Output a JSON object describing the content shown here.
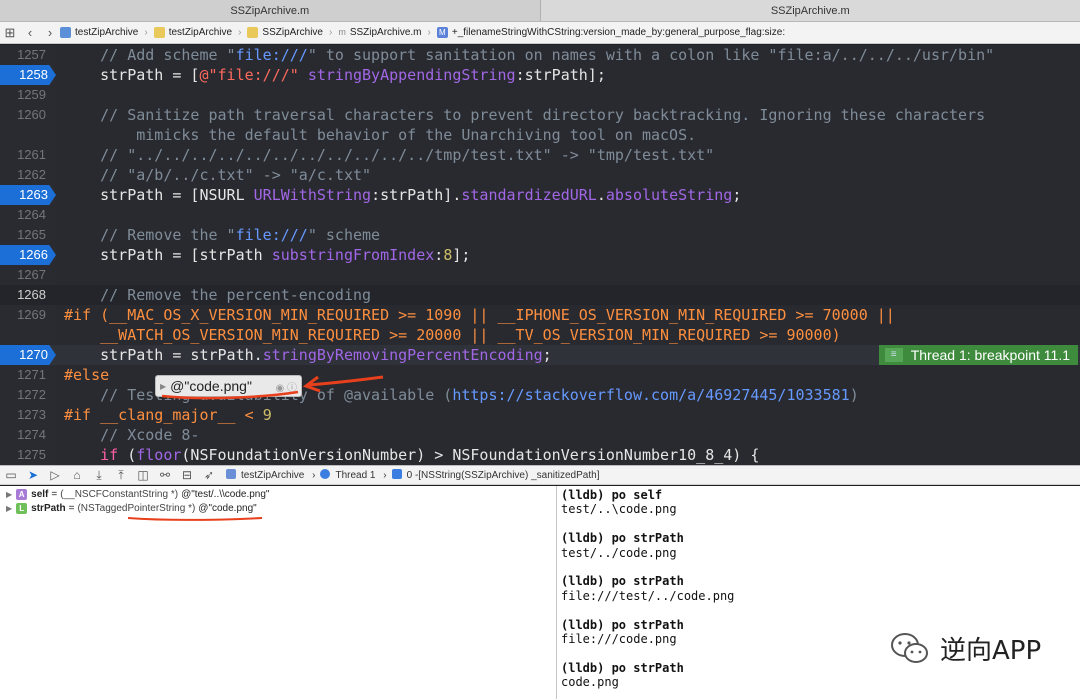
{
  "window": {
    "tab_left": "SSZipArchive.m",
    "tab_right": "SSZipArchive.m"
  },
  "jumpbar": {
    "crumbs": [
      "testZipArchive",
      "testZipArchive",
      "SSZipArchive",
      "SSZipArchive.m",
      "+_filenameStringWithCString:version_made_by:general_purpose_flag:size:"
    ],
    "m_label": "m",
    "M_label": "M"
  },
  "editor": {
    "lines": [
      {
        "n": "1257"
      },
      {
        "n": "1258"
      },
      {
        "n": "1259"
      },
      {
        "n": "1260"
      },
      {
        "n": ""
      },
      {
        "n": "1261"
      },
      {
        "n": "1262"
      },
      {
        "n": "1263"
      },
      {
        "n": "1264"
      },
      {
        "n": "1265"
      },
      {
        "n": "1266"
      },
      {
        "n": "1267"
      },
      {
        "n": "1268"
      },
      {
        "n": "1269"
      },
      {
        "n": ""
      },
      {
        "n": "1270"
      },
      {
        "n": "1271"
      },
      {
        "n": "1272"
      },
      {
        "n": "1273"
      },
      {
        "n": "1274"
      },
      {
        "n": "1275"
      }
    ],
    "thread_badge": "Thread 1: breakpoint 11.1",
    "popover_value": "@\"code.png\"",
    "popover_icons": "◉ ⓘ"
  },
  "debugbar": {
    "crumbs": [
      "testZipArchive",
      "Thread 1",
      "0 -[NSString(SSZipArchive) _sanitizedPath]"
    ]
  },
  "variables": [
    {
      "badge": "A",
      "name": "self",
      "eq": "=",
      "type": "(__NSCFConstantString *)",
      "value": "@\"test/..\\\\code.png\""
    },
    {
      "badge": "L",
      "name": "strPath",
      "eq": "=",
      "type": "(NSTaggedPointerString *)",
      "value": "@\"code.png\""
    }
  ],
  "console": {
    "lines": [
      "(lldb) po self",
      "test/..\\code.png",
      "",
      "(lldb) po strPath",
      "test/../code.png",
      "",
      "(lldb) po strPath",
      "file:///test/../code.png",
      "",
      "(lldb) po strPath",
      "file:///code.png",
      "",
      "(lldb) po strPath",
      "code.png"
    ]
  },
  "watermark": {
    "text": "逆向APP"
  },
  "colors": {
    "breakpoint": "#1b6fd6",
    "thread_badge": "#3e8b3e",
    "annotation": "#e8401c"
  }
}
